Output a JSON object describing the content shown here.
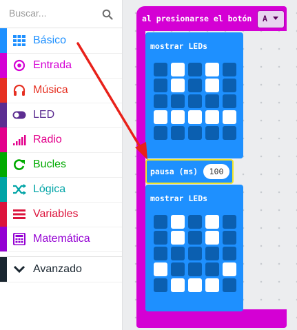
{
  "search": {
    "placeholder": "Buscar..."
  },
  "categories": [
    {
      "label": "Básico",
      "color": "#1e90ff",
      "icon": "grid-icon"
    },
    {
      "label": "Entrada",
      "color": "#d400d4",
      "icon": "target-icon"
    },
    {
      "label": "Música",
      "color": "#e63022",
      "icon": "headphones-icon"
    },
    {
      "label": "LED",
      "color": "#5c2d91",
      "icon": "toggle-icon"
    },
    {
      "label": "Radio",
      "color": "#e3008c",
      "icon": "signal-icon"
    },
    {
      "label": "Bucles",
      "color": "#00aa00",
      "icon": "refresh-icon"
    },
    {
      "label": "Lógica",
      "color": "#00a4a6",
      "icon": "shuffle-icon"
    },
    {
      "label": "Variables",
      "color": "#dc143c",
      "icon": "list-icon"
    },
    {
      "label": "Matemática",
      "color": "#9400d3",
      "icon": "calculator-icon"
    }
  ],
  "advanced": {
    "label": "Avanzado",
    "icon": "chevron-down-icon"
  },
  "event_block": {
    "label": "al presionarse el botón",
    "dropdown": "A"
  },
  "show_leds_1": {
    "label": "mostrar LEDs",
    "grid": [
      [
        0,
        1,
        0,
        1,
        0
      ],
      [
        0,
        1,
        0,
        1,
        0
      ],
      [
        0,
        0,
        0,
        0,
        0
      ],
      [
        1,
        1,
        1,
        1,
        1
      ],
      [
        0,
        0,
        0,
        0,
        0
      ]
    ]
  },
  "pause_block": {
    "label": "pausa (ms)",
    "value": "100"
  },
  "show_leds_2": {
    "label": "mostrar LEDs",
    "grid": [
      [
        0,
        1,
        0,
        1,
        0
      ],
      [
        0,
        1,
        0,
        1,
        0
      ],
      [
        0,
        0,
        0,
        0,
        0
      ],
      [
        1,
        0,
        0,
        0,
        1
      ],
      [
        0,
        1,
        1,
        1,
        0
      ]
    ]
  }
}
